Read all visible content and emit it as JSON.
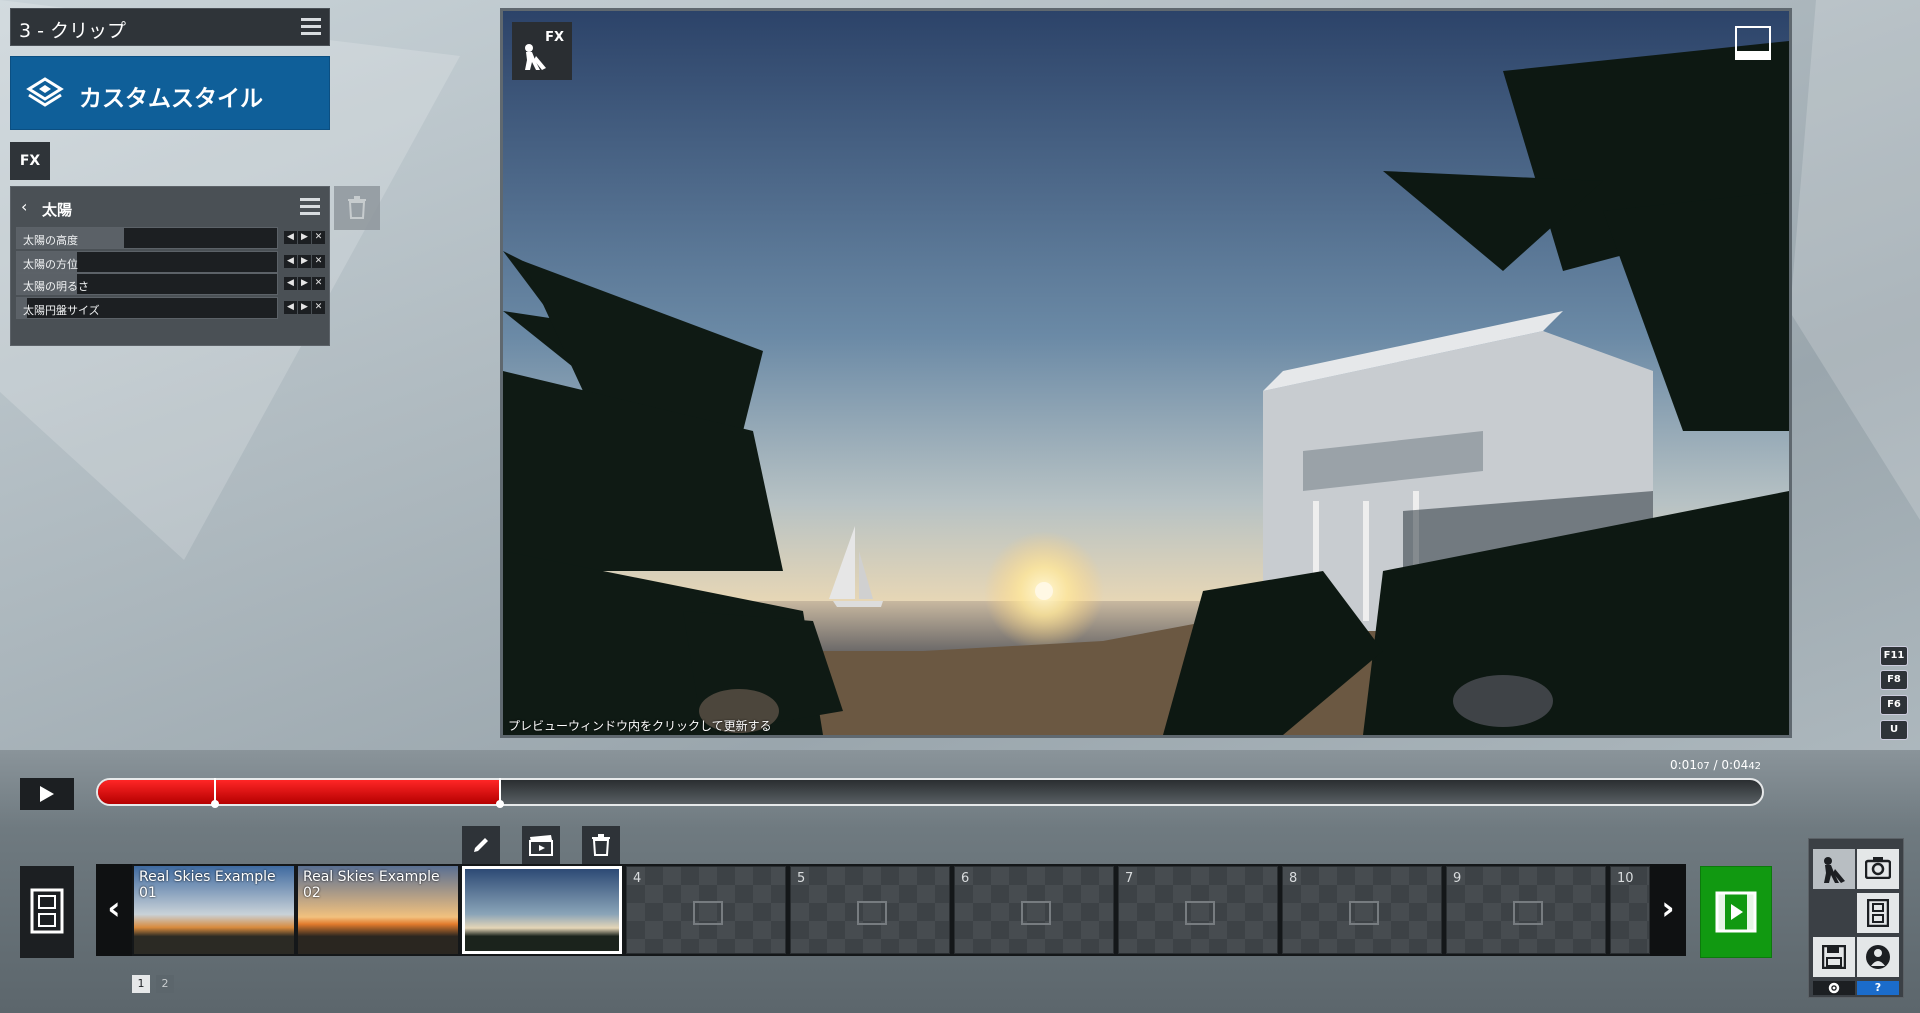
{
  "clip_header": {
    "title": "3 - クリップ"
  },
  "style_button": {
    "label": "カスタムスタイル"
  },
  "fx_badge": {
    "label": "FX"
  },
  "panel": {
    "title": "太陽",
    "sliders": [
      {
        "label": "太陽の高度",
        "value": 0.41
      },
      {
        "label": "太陽の方位",
        "value": 0.23
      },
      {
        "label": "太陽の明るさ",
        "value": 0.23
      },
      {
        "label": "太陽円盤サイズ",
        "value": 0.04
      }
    ]
  },
  "preview": {
    "fx_label": "FX",
    "hint": "プレビューウィンドウ内をクリックして更新する"
  },
  "shortcuts": [
    "F11",
    "F8",
    "F6",
    "U"
  ],
  "timeline": {
    "time_current": "0:01",
    "time_current_frac": "07",
    "time_total": "0:04",
    "time_total_frac": "42",
    "progress": 0.241,
    "marker": 0.07
  },
  "clips": [
    {
      "name": "Real Skies Example 01",
      "type": "filled"
    },
    {
      "name": "Real Skies Example 02",
      "type": "filled"
    },
    {
      "name": "",
      "type": "selected"
    },
    {
      "num": "4",
      "type": "empty"
    },
    {
      "num": "5",
      "type": "empty"
    },
    {
      "num": "6",
      "type": "empty"
    },
    {
      "num": "7",
      "type": "empty"
    },
    {
      "num": "8",
      "type": "empty"
    },
    {
      "num": "9",
      "type": "empty"
    },
    {
      "num": "10",
      "type": "empty"
    }
  ],
  "pages": [
    "1",
    "2"
  ],
  "colors": {
    "accent_blue": "#0f5f99",
    "progress_red": "#e00000",
    "add_green": "#119911"
  }
}
